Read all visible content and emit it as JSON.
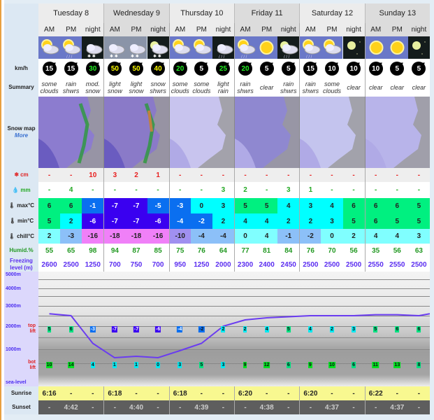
{
  "labels": {
    "wind": "km/h",
    "summary": "Summary",
    "snow_map": "Snow map",
    "more": "More",
    "snow_cm": "cm",
    "rain_mm": "mm",
    "max": "max°C",
    "min": "min°C",
    "chill": "chill°C",
    "humid": "Humid.%",
    "freezing": "Freezing level (m)",
    "sunrise": "Sunrise",
    "sunset": "Sunset",
    "top_lift": "top lift",
    "bot_lift": "bot lift",
    "sea_level": "sea-level",
    "altitudes": [
      "5000m",
      "4000m",
      "3000m",
      "2000m",
      "1000m"
    ]
  },
  "days": [
    "Tuesday 8",
    "Wednesday 9",
    "Thursday 10",
    "Friday 11",
    "Saturday 12",
    "Sunday 13"
  ],
  "periods": [
    "AM",
    "PM",
    "night"
  ],
  "icons": [
    "sun-cloud",
    "sun-cloud-rain",
    "night-cloud-snow",
    "cloud-snow",
    "cloud-snow",
    "moon-cloud-snow",
    "sun-cloud",
    "sun-cloud",
    "night-cloud-rain",
    "sun-cloud-rain",
    "sun",
    "moon-cloud-rain",
    "sun-cloud-rain",
    "sun-cloud",
    "moon",
    "sun",
    "sun",
    "moon"
  ],
  "wind": [
    15,
    15,
    30,
    50,
    50,
    40,
    20,
    5,
    25,
    20,
    5,
    5,
    15,
    10,
    10,
    10,
    5,
    5
  ],
  "wind_colors": {
    "5": "#ffffff",
    "10": "#ffffff",
    "15": "#ffffff",
    "20": "#22ee22",
    "25": "#22ee22",
    "30": "#22ee22",
    "40": "#ffff00",
    "50": "#ffff00"
  },
  "summary": [
    "some clouds",
    "rain shwrs",
    "mod. snow",
    "light snow",
    "light snow",
    "snow shwrs",
    "some clouds",
    "some clouds",
    "light rain",
    "rain shwrs",
    "clear",
    "rain shwrs",
    "rain shwrs",
    "some clouds",
    "clear",
    "clear",
    "clear",
    "clear"
  ],
  "snow_cm": [
    "-",
    "-",
    "10",
    "3",
    "2",
    "1",
    "-",
    "-",
    "-",
    "-",
    "-",
    "-",
    "-",
    "-",
    "-",
    "-",
    "-",
    "-"
  ],
  "rain_mm": [
    "-",
    "4",
    "-",
    "-",
    "-",
    "-",
    "-",
    "-",
    "3",
    "2",
    "-",
    "3",
    "1",
    "-",
    "-",
    "-",
    "-",
    "-"
  ],
  "max_c": [
    "6",
    "6",
    "-1",
    "-7",
    "-7",
    "-5",
    "-3",
    "0",
    "3",
    "5",
    "5",
    "4",
    "3",
    "4",
    "6",
    "6",
    "6",
    "5"
  ],
  "min_c": [
    "5",
    "2",
    "-6",
    "-7",
    "-7",
    "-6",
    "-4",
    "-2",
    "2",
    "4",
    "4",
    "2",
    "2",
    "3",
    "5",
    "6",
    "5",
    "5"
  ],
  "chill_c": [
    "2",
    "-3",
    "-16",
    "-18",
    "-18",
    "-16",
    "-10",
    "-4",
    "-4",
    "0",
    "4",
    "-1",
    "-2",
    "0",
    "2",
    "4",
    "4",
    "3"
  ],
  "humidity": [
    "55",
    "65",
    "98",
    "94",
    "87",
    "85",
    "75",
    "76",
    "64",
    "77",
    "81",
    "84",
    "76",
    "70",
    "56",
    "35",
    "56",
    "63"
  ],
  "freezing_level": [
    "2600",
    "2500",
    "1250",
    "700",
    "750",
    "700",
    "950",
    "1250",
    "2000",
    "2300",
    "2400",
    "2450",
    "2500",
    "2500",
    "2500",
    "2550",
    "2550",
    "2500"
  ],
  "top_lift_c": [
    "5",
    "6",
    "-3",
    "-7",
    "-7",
    "-6",
    "-4",
    "-2",
    "2",
    "2",
    "4",
    "5",
    "4",
    "2",
    "3",
    "5",
    "6",
    "6",
    "5"
  ],
  "bot_lift_c": [
    "10",
    "14",
    "4",
    "1",
    "1",
    "0",
    "3",
    "5",
    "3",
    "9",
    "12",
    "6",
    "9",
    "10",
    "6",
    "11",
    "13",
    "8"
  ],
  "sunrise": [
    "6:16",
    "-",
    "-",
    "6:18",
    "-",
    "-",
    "6:18",
    "-",
    "-",
    "6:20",
    "-",
    "-",
    "6:20",
    "-",
    "-",
    "6:22",
    "-",
    "-"
  ],
  "sunset": [
    "-",
    "4:42",
    "-",
    "-",
    "4:40",
    "-",
    "-",
    "4:39",
    "-",
    "-",
    "4:38",
    "-",
    "-",
    "4:37",
    "-",
    "-",
    "4:37",
    "-"
  ],
  "colors": {
    "freezing_line": "#6a3cf0",
    "snow_text": "#e82020",
    "rain_text": "#22a822",
    "humid_text": "#229922",
    "freezing_text": "#5a2cf0"
  }
}
